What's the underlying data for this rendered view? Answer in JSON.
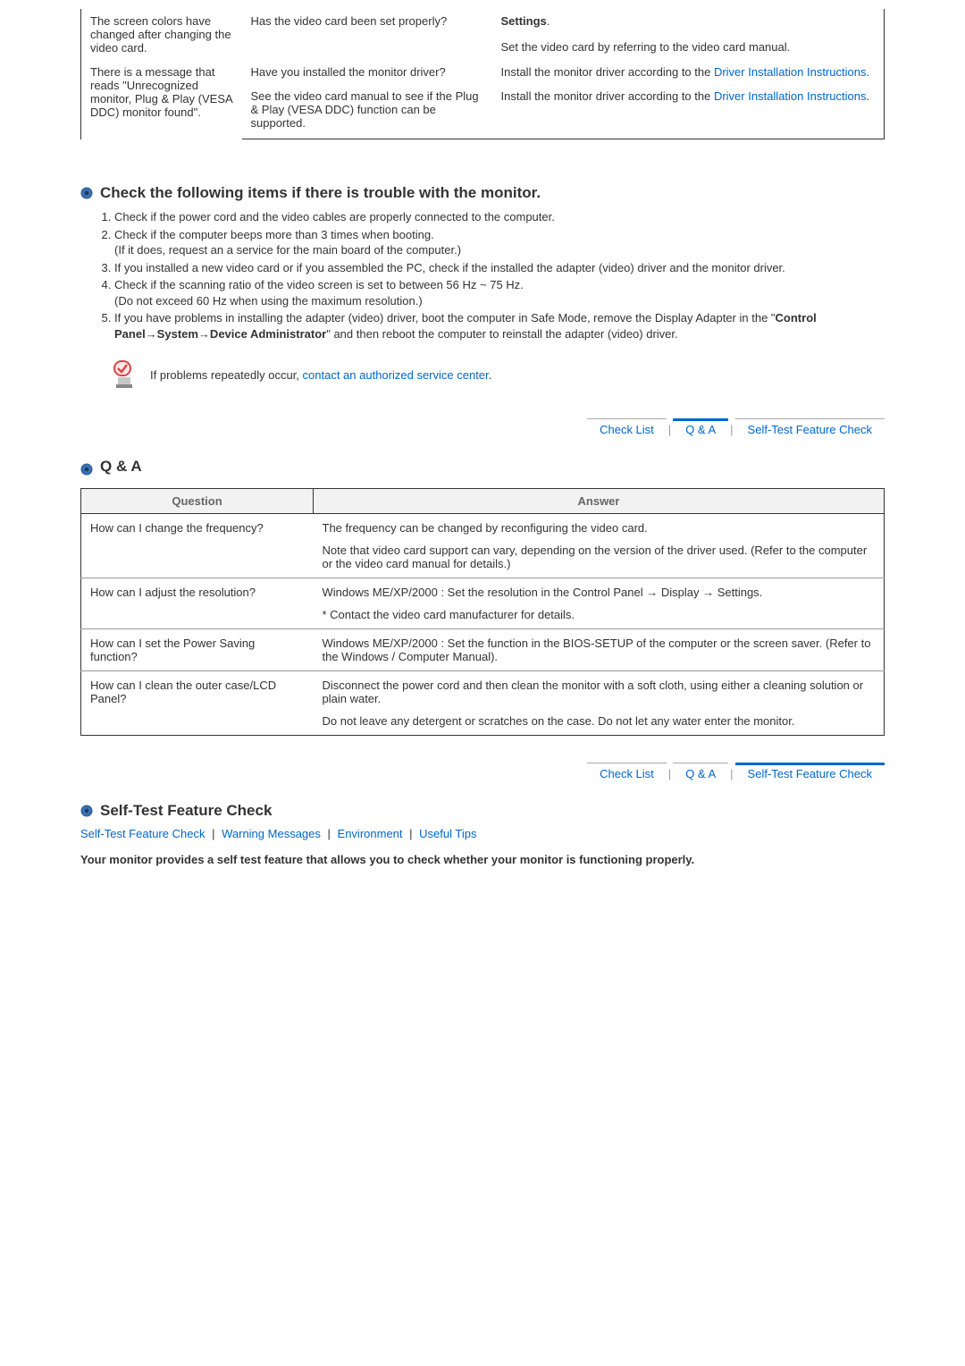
{
  "troubleshoot": {
    "rows": [
      {
        "symptom": "The screen colors have changed after changing the video card.",
        "check": "Has the video card been set properly?",
        "solution_prefix": "",
        "solution_bold": "Settings",
        "solution_suffix": ".",
        "solution2": "Set the video card by referring to the video card manual."
      },
      {
        "symptom": "There is a message that reads \"Unrecognized monitor, Plug & Play (VESA DDC) monitor found\".",
        "check": "Have you installed the monitor driver?",
        "solution_text": "Install the monitor driver according to the ",
        "solution_link": "Driver Installation Instructions",
        "solution_end": "."
      },
      {
        "check": "See the video card manual to see if the Plug & Play (VESA DDC) function can be supported.",
        "solution_text": "Install the monitor driver according to the ",
        "solution_link": "Driver Installation Instructions",
        "solution_end": "."
      }
    ]
  },
  "checklist": {
    "heading": "Check the following items if there is trouble with the monitor.",
    "items": [
      "Check if the power cord and the video cables are properly connected to the computer.",
      "Check if the computer beeps more than 3 times when booting.",
      "If you installed a new video card or if you assembled the PC, check if the installed the adapter (video) driver and the monitor driver.",
      "Check if the scanning ratio of the video screen is set to between 56 Hz ~ 75 Hz.",
      "If you have problems in installing the adapter (video) driver, boot the computer in Safe Mode, remove the Display Adapter in the \"Control Panel→System→Device Administrator\" and then reboot the computer to reinstall the adapter (video) driver."
    ],
    "item2_note": "(If it does, request an a service for the main board of the computer.)",
    "item4_note": "(Do not exceed 60 Hz when using the maximum resolution.)",
    "item5_part1": "If you have problems in installing the adapter (video) driver, boot the computer in Safe Mode, remove the Display Adapter in the \"",
    "item5_bold": "Control Panel→System→Device Administrator",
    "item5_part2": "\" and then reboot the computer to reinstall the adapter (video) driver.",
    "note_prefix": "If problems repeatedly occur, ",
    "note_link": "contact an authorized service center",
    "note_suffix": "."
  },
  "nav": {
    "check_list": "Check List",
    "qa": "Q & A",
    "selftest": "Self-Test Feature Check"
  },
  "qa": {
    "title": "Q & A",
    "headers": {
      "question": "Question",
      "answer": "Answer"
    },
    "rows": [
      {
        "q": "How can I change the frequency?",
        "a1": "The frequency can be changed by reconfiguring the video card.",
        "a2": "Note that video card support can vary, depending on the version of the driver used. (Refer to the computer or the video card manual for details.)"
      },
      {
        "q": "How can I adjust the resolution?",
        "a1": "Windows ME/XP/2000 : Set the resolution in the Control Panel → Display → Settings.",
        "a2": "* Contact the video card manufacturer for details."
      },
      {
        "q": "How can I set the Power Saving function?",
        "a1": "Windows ME/XP/2000 : Set the function in the BIOS-SETUP of the computer or the screen saver. (Refer to the Windows / Computer Manual)."
      },
      {
        "q": "How can I clean the outer case/LCD Panel?",
        "a1": "Disconnect the power cord and then clean the monitor with a soft cloth, using either a cleaning solution or plain water.",
        "a2": "Do not leave any detergent or scratches on the case. Do not let any water enter the monitor."
      }
    ]
  },
  "selftest": {
    "heading": "Self-Test Feature Check",
    "links": [
      "Self-Test Feature Check",
      "Warning Messages",
      "Environment",
      "Useful Tips"
    ],
    "intro": "Your monitor provides a self test feature that allows you to check whether your monitor is functioning properly."
  }
}
